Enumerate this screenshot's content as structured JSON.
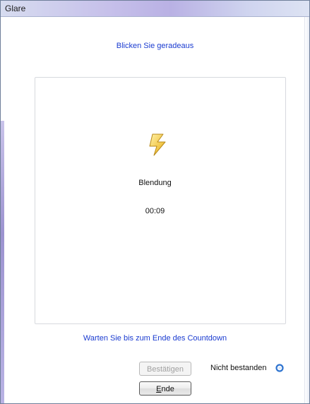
{
  "window": {
    "title": "Glare"
  },
  "instruction": "Blicken Sie geradeaus",
  "test": {
    "icon": "lightning-bolt-icon",
    "name": "Blendung",
    "timer": "00:09"
  },
  "countdown_message": "Warten Sie bis zum Ende des Countdown",
  "buttons": {
    "confirm_label": "Bestätigen",
    "end_label": "Ende"
  },
  "status": {
    "label": "Nicht bestanden",
    "icon": "status-ring-icon"
  },
  "colors": {
    "instruction_text": "#1a3bd0",
    "icon_fill": "#f2c84b",
    "status_ring": "#2f74d0"
  }
}
